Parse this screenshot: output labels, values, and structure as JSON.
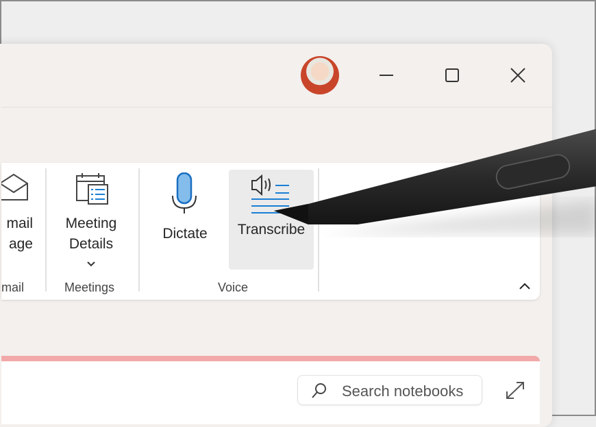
{
  "titlebar": {
    "minimize_icon": "minimize-icon",
    "maximize_icon": "maximize-icon",
    "close_icon": "close-icon"
  },
  "ribbon": {
    "email_label_1": "mail",
    "email_label_2": "age",
    "email_group": "mail",
    "meeting_label_1": "Meeting",
    "meeting_label_2": "Details",
    "meetings_group": "Meetings",
    "dictate_label": "Dictate",
    "transcribe_label": "Transcribe",
    "voice_group": "Voice",
    "accent": "#1a7fd4"
  },
  "panel": {
    "search_placeholder": "Search notebooks",
    "accent": "#f2a9a9"
  }
}
